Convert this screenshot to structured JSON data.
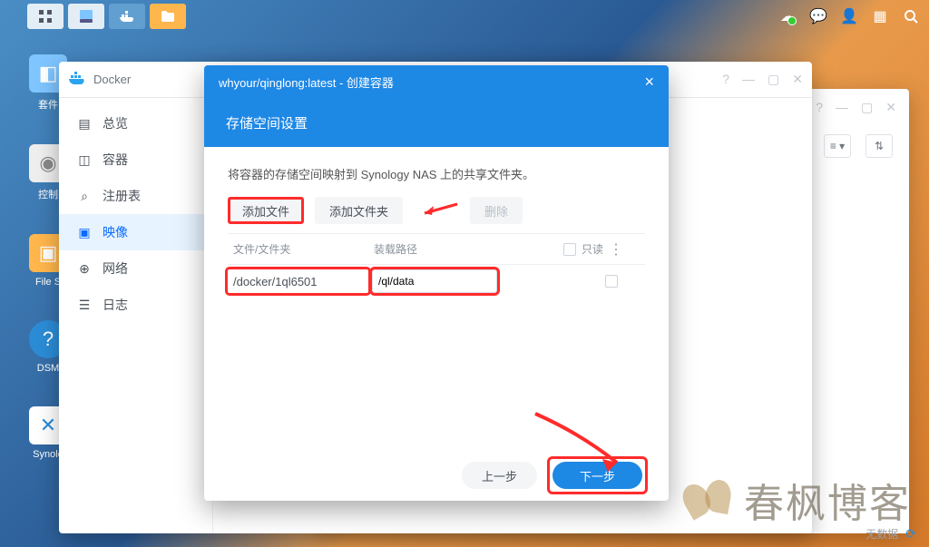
{
  "taskbar": {
    "right_icons": [
      "cloud-health-icon",
      "chat-icon",
      "user-icon",
      "dashboard-icon",
      "search-icon"
    ]
  },
  "desktop_icons": {
    "package_center": "套件",
    "control_panel": "控制",
    "file_station": "File S",
    "dsm": "DSM",
    "synology": "Synolo"
  },
  "docker": {
    "title": "Docker",
    "sidebar": [
      {
        "icon": "overview-icon",
        "label": "总览"
      },
      {
        "icon": "container-icon",
        "label": "容器"
      },
      {
        "icon": "registry-icon",
        "label": "注册表"
      },
      {
        "icon": "image-icon",
        "label": "映像"
      },
      {
        "icon": "network-icon",
        "label": "网络"
      },
      {
        "icon": "log-icon",
        "label": "日志"
      }
    ],
    "active_index": 3
  },
  "modal": {
    "title": "whyour/qinglong:latest - 创建容器",
    "subtitle": "存储空间设置",
    "description": "将容器的存储空间映射到 Synology NAS 上的共享文件夹。",
    "buttons": {
      "add_file": "添加文件",
      "add_folder": "添加文件夹",
      "delete": "删除"
    },
    "columns": {
      "folder": "文件/文件夹",
      "mount": "装载路径",
      "readonly": "只读"
    },
    "row": {
      "folder": "/docker/1ql6501",
      "mount": "/ql/data"
    },
    "footer": {
      "prev": "上一步",
      "next": "下一步"
    }
  },
  "status": {
    "text": "无数据"
  },
  "watermark": {
    "text": "春枫博客"
  }
}
